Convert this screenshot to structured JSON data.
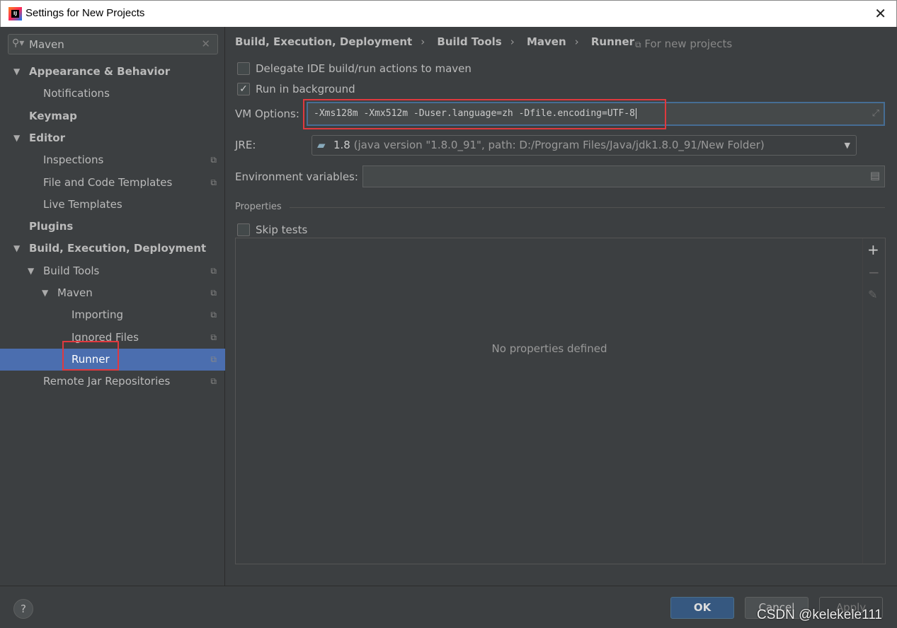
{
  "window": {
    "title": "Settings for New Projects",
    "close": "✕"
  },
  "search": {
    "value": "Maven"
  },
  "tree": [
    {
      "label": "Appearance & Behavior",
      "level": 0,
      "expanded": true,
      "bold": true
    },
    {
      "label": "Notifications",
      "level": 1
    },
    {
      "label": "Keymap",
      "level": 0,
      "bold": true
    },
    {
      "label": "Editor",
      "level": 0,
      "expanded": true,
      "bold": true
    },
    {
      "label": "Inspections",
      "level": 1,
      "copy": true
    },
    {
      "label": "File and Code Templates",
      "level": 1,
      "copy": true
    },
    {
      "label": "Live Templates",
      "level": 1
    },
    {
      "label": "Plugins",
      "level": 0,
      "bold": true
    },
    {
      "label": "Build, Execution, Deployment",
      "level": 0,
      "expanded": true,
      "bold": true
    },
    {
      "label": "Build Tools",
      "level": 1,
      "expanded": true,
      "copy": true
    },
    {
      "label": "Maven",
      "level": 2,
      "expanded": true,
      "copy": true
    },
    {
      "label": "Importing",
      "level": 3,
      "copy": true
    },
    {
      "label": "Ignored Files",
      "level": 3,
      "copy": true
    },
    {
      "label": "Runner",
      "level": 3,
      "copy": true,
      "selected": true
    },
    {
      "label": "Remote Jar Repositories",
      "level": 1,
      "copy": true
    }
  ],
  "breadcrumb": [
    "Build, Execution, Deployment",
    "Build Tools",
    "Maven",
    "Runner"
  ],
  "for_new_projects": "For new projects",
  "options": {
    "delegate": {
      "label": "Delegate IDE build/run actions to maven",
      "checked": false
    },
    "background": {
      "label": "Run in background",
      "checked": true
    },
    "vm_label": "VM Options:",
    "vm_value": "-Xms128m -Xmx512m -Duser.language=zh -Dfile.encoding=UTF-8",
    "jre_label": "JRE:",
    "jre_version": "1.8",
    "jre_detail": "(java version \"1.8.0_91\", path: D:/Program Files/Java/jdk1.8.0_91/New Folder)",
    "env_label": "Environment variables:",
    "env_value": "",
    "properties_label": "Properties",
    "skip_tests": {
      "label": "Skip tests",
      "checked": false
    },
    "empty_text": "No properties defined"
  },
  "buttons": {
    "ok": "OK",
    "cancel": "Cancel",
    "apply": "Apply",
    "help": "?"
  },
  "watermark": "CSDN @kelekele111",
  "colors": {
    "selection": "#4b6eaf",
    "highlight": "#e0393e",
    "ok": "#365880"
  }
}
